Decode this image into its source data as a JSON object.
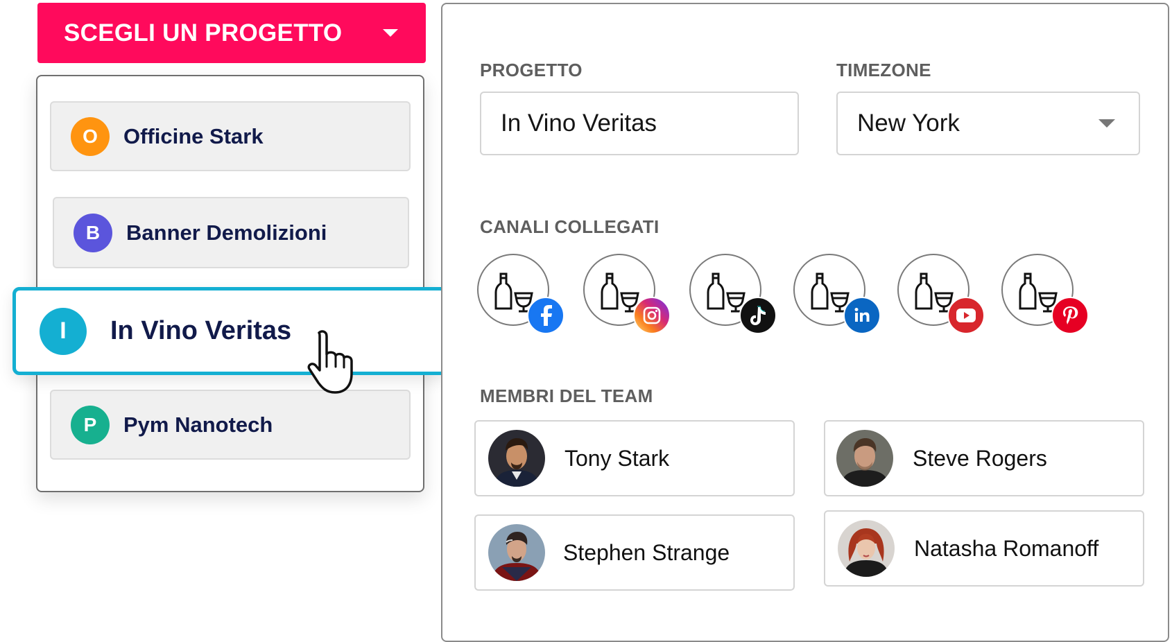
{
  "picker": {
    "label": "SCEGLI UN PROGETTO"
  },
  "projects": [
    {
      "letter": "O",
      "name": "Officine Stark",
      "color": "#ff9410"
    },
    {
      "letter": "B",
      "name": "Banner Demolizioni",
      "color": "#5b55dc"
    },
    {
      "letter": "I",
      "name": "In Vino Veritas",
      "color": "#14afd2",
      "selected": true
    },
    {
      "letter": "P",
      "name": "Pym Nanotech",
      "color": "#17b08f"
    }
  ],
  "panel": {
    "project_label": "PROGETTO",
    "project_value": "In Vino Veritas",
    "timezone_label": "TIMEZONE",
    "timezone_value": "New York",
    "channels_label": "CANALI COLLEGATI",
    "channels": [
      {
        "network": "facebook",
        "icon": "facebook-icon",
        "color": "#1877f2"
      },
      {
        "network": "instagram",
        "icon": "instagram-icon",
        "color": "#d62976"
      },
      {
        "network": "tiktok",
        "icon": "tiktok-icon",
        "color": "#111111"
      },
      {
        "network": "linkedin",
        "icon": "linkedin-icon",
        "color": "#0a66c2"
      },
      {
        "network": "youtube",
        "icon": "youtube-icon",
        "color": "#e52d27"
      },
      {
        "network": "pinterest",
        "icon": "pinterest-icon",
        "color": "#e60023"
      }
    ],
    "team_label": "MEMBRI DEL TEAM",
    "team": [
      {
        "name": "Tony Stark"
      },
      {
        "name": "Steve Rogers"
      },
      {
        "name": "Stephen Strange"
      },
      {
        "name": "Natasha Romanoff"
      }
    ]
  }
}
